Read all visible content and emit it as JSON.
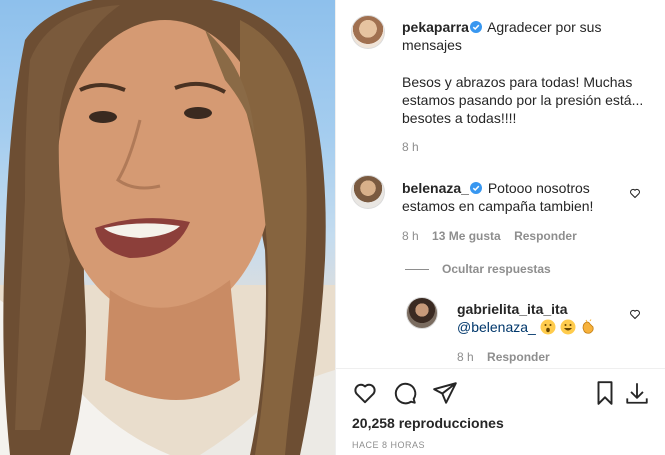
{
  "post": {
    "author": "pekaparra",
    "caption_lines": [
      "Agradecer por sus",
      "mensajes"
    ],
    "caption_body_lines": [
      "Besos y abrazos para todas! Muchas",
      "estamos pasando por la presión está...",
      "besotes a todas!!!!"
    ],
    "time": "8 h"
  },
  "comments": [
    {
      "username": "belenaza_",
      "text_lines": [
        "Potooo nosotros",
        "estamos en campaña tambien!"
      ],
      "time": "8 h",
      "likes": "13 Me gusta",
      "reply_label": "Responder"
    }
  ],
  "hide_replies_label": "Ocultar respuestas",
  "reply": {
    "username": "gabrielita_ita_ita",
    "mention": "@belenaza_",
    "time": "8 h",
    "reply_label": "Responder"
  },
  "footer": {
    "views": "20,258 reproducciones",
    "posted": "HACE 8 HORAS"
  },
  "icons": {
    "like": "heart-icon",
    "comment": "comment-icon",
    "share": "paper-plane-icon",
    "save": "bookmark-icon",
    "download": "download-icon",
    "verified": "verified-badge-icon",
    "emojis": [
      "surprised-face-emoji",
      "grinning-face-emoji",
      "clapping-hands-emoji"
    ]
  },
  "colors": {
    "verified": "#3897f0",
    "secondary_text": "#8e8e8e",
    "mention": "#00376b"
  }
}
